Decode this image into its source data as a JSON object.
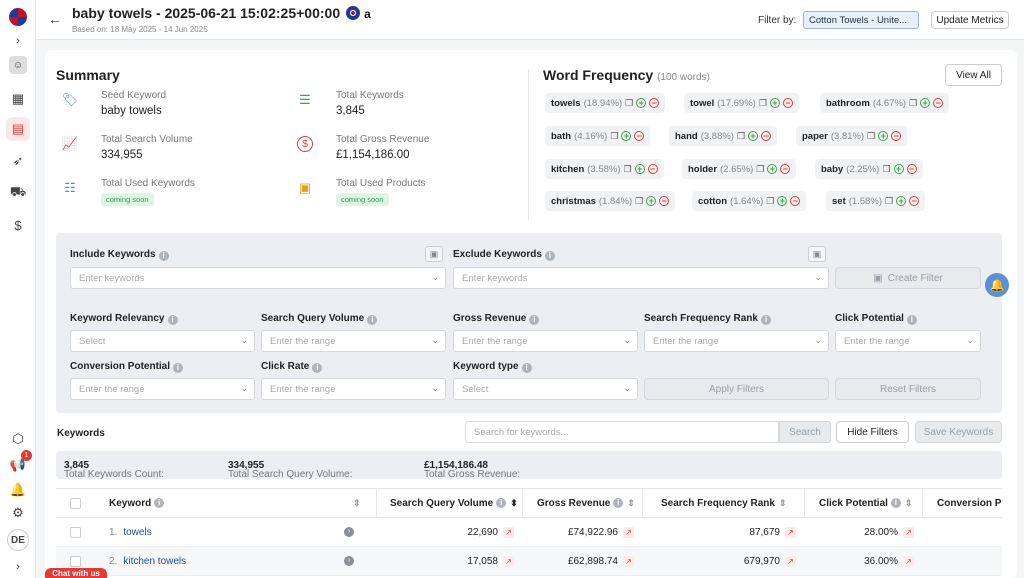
{
  "header": {
    "title": "baby towels - 2025-06-21 15:02:25+00:00",
    "amazon_mark": "a",
    "subtitle": "Based on: 18 May 2025 - 14 Jun 2025",
    "filter_by_label": "Filter by:",
    "filter_value": "Cotton Towels - Unite...",
    "update_metrics_label": "Update Metrics"
  },
  "rail": {
    "avatar_initials": "DE",
    "notifications_count": "1"
  },
  "summary": {
    "title": "Summary",
    "seed_keyword_label": "Seed Keyword",
    "seed_keyword_value": "baby towels",
    "total_keywords_label": "Total Keywords",
    "total_keywords_value": "3,845",
    "total_search_volume_label": "Total Search Volume",
    "total_search_volume_value": "334,955",
    "total_gross_revenue_label": "Total Gross Revenue",
    "total_gross_revenue_value": "£1,154,186.00",
    "total_used_keywords_label": "Total Used Keywords",
    "total_used_products_label": "Total Used Products",
    "coming_soon": "coming soon"
  },
  "word_frequency": {
    "title": "Word Frequency",
    "count_note": "(100 words)",
    "view_all_label": "View All",
    "words": [
      {
        "word": "towels",
        "pct": "(18.94%)"
      },
      {
        "word": "towel",
        "pct": "(17.69%)"
      },
      {
        "word": "bathroom",
        "pct": "(4.67%)"
      },
      {
        "word": "bath",
        "pct": "(4.16%)"
      },
      {
        "word": "hand",
        "pct": "(3.88%)"
      },
      {
        "word": "paper",
        "pct": "(3.81%)"
      },
      {
        "word": "kitchen",
        "pct": "(3.58%)"
      },
      {
        "word": "holder",
        "pct": "(2.65%)"
      },
      {
        "word": "baby",
        "pct": "(2.25%)"
      },
      {
        "word": "christmas",
        "pct": "(1.84%)"
      },
      {
        "word": "cotton",
        "pct": "(1.64%)"
      },
      {
        "word": "set",
        "pct": "(1.58%)"
      }
    ]
  },
  "filters": {
    "include_label": "Include Keywords",
    "include_placeholder": "Enter keywords",
    "exclude_label": "Exclude Keywords",
    "exclude_placeholder": "Enter keywords",
    "create_filter_label": "Create Filter",
    "keyword_relevancy_label": "Keyword Relevancy",
    "keyword_relevancy_placeholder": "Select",
    "search_query_volume_label": "Search Query Volume",
    "search_query_volume_placeholder": "Enter the range",
    "gross_revenue_label": "Gross Revenue",
    "gross_revenue_placeholder": "Enter the range",
    "search_frequency_rank_label": "Search Frequency Rank",
    "search_frequency_rank_placeholder": "Enter the range",
    "click_potential_label": "Click Potential",
    "click_potential_placeholder": "Enter the range",
    "conversion_potential_label": "Conversion Potential",
    "conversion_potential_placeholder": "Enter the range",
    "click_rate_label": "Click Rate",
    "click_rate_placeholder": "Enter the range",
    "keyword_type_label": "Keyword type",
    "keyword_type_placeholder": "Select",
    "apply_filters_label": "Apply Filters",
    "reset_filters_label": "Reset Filters"
  },
  "keywords": {
    "title": "Keywords",
    "search_placeholder": "Search for keywords...",
    "search_button": "Search",
    "hide_filters_label": "Hide Filters",
    "save_keywords_label": "Save Keywords",
    "stats": {
      "count_label": "Total Keywords Count:",
      "count_value": "3,845",
      "volume_label": "Total Search Query Volume:",
      "volume_value": "334,955",
      "revenue_label": "Total Gross Revenue:",
      "revenue_value": "£1,154,186.48"
    },
    "columns": [
      "Keyword",
      "Search Query Volume",
      "Gross Revenue",
      "Search Frequency Rank",
      "Click Potential",
      "Conversion Pot"
    ],
    "rows": [
      {
        "num": "1.",
        "keyword": "towels",
        "volume": "22,690",
        "revenue": "£74,922.96",
        "rank": "87,679",
        "click": "28.00%"
      },
      {
        "num": "2.",
        "keyword": "kitchen towels",
        "volume": "17,058",
        "revenue": "£62,898.74",
        "rank": "679,970",
        "click": "36.00%"
      }
    ]
  },
  "chat_label": "Chat with us",
  "colors": {
    "accent": "#e53935",
    "brand_blue": "#1f3a93",
    "link": "#1f4e8c"
  },
  "icons": [
    "back-arrow-icon",
    "tag-icon",
    "list-icon",
    "chart-line-icon",
    "pound-coin-icon",
    "checklist-icon",
    "box-icon",
    "bell-icon",
    "copy-icon",
    "plus-circle-icon",
    "minus-circle-icon",
    "info-icon",
    "sort-icon",
    "trend-icon"
  ]
}
